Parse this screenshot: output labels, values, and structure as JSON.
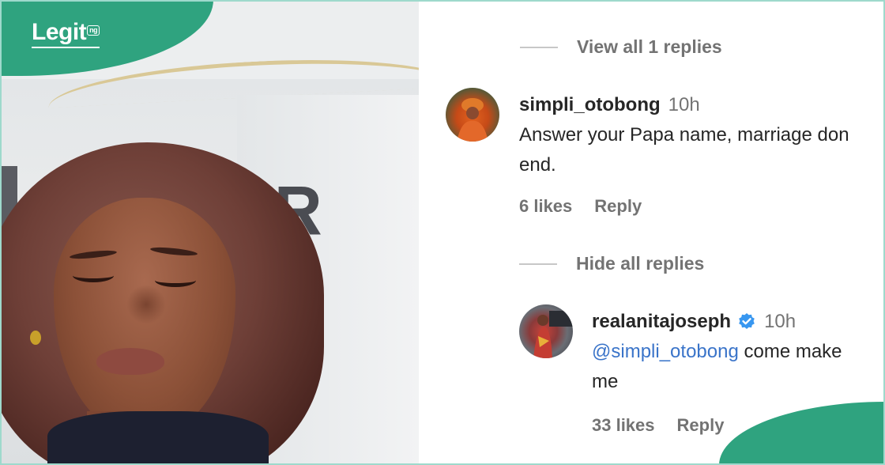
{
  "brand": {
    "logo_text": "Legit",
    "logo_tld": "ng",
    "accent": "#2fa37f"
  },
  "photo": {
    "sign_text": "AIR"
  },
  "thread": {
    "view_replies_label": "View all 1 replies",
    "comment": {
      "username": "simpli_otobong",
      "time": "10h",
      "text": "Answer your Papa name, marriage don end.",
      "likes": "6 likes",
      "reply_label": "Reply"
    },
    "hide_replies_label": "Hide all replies",
    "reply": {
      "username": "realanitajoseph",
      "verified": true,
      "time": "10h",
      "mention": "@simpli_otobong",
      "text": " come make me",
      "likes": "33 likes",
      "reply_label": "Reply",
      "more_label": "•••"
    }
  },
  "colors": {
    "mention": "#3a74c9",
    "verified_badge": "#3897f0",
    "muted": "#737373"
  }
}
